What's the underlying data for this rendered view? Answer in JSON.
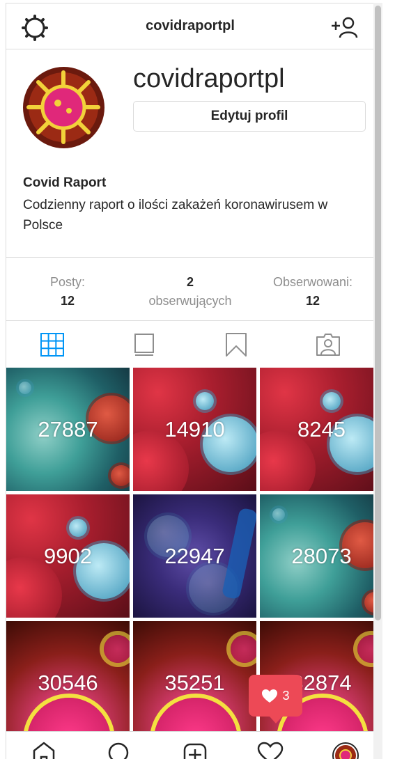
{
  "header": {
    "title": "covidraportpl",
    "settings_icon": "settings-gear-icon",
    "add_user_icon": "add-user-icon"
  },
  "profile": {
    "username": "covidraportpl",
    "edit_button": "Edytuj profil",
    "full_name": "Covid Raport",
    "bio": "Codzienny raport o ilości zakażeń koronawirusem w Polsce"
  },
  "stats": {
    "posts_label": "Posty:",
    "posts_value": "12",
    "followers_value": "2",
    "followers_label": "obserwujących",
    "following_label": "Obserwowani:",
    "following_value": "12"
  },
  "tabs": [
    {
      "name": "grid",
      "icon": "grid-icon",
      "active": true
    },
    {
      "name": "feed",
      "icon": "feed-icon",
      "active": false
    },
    {
      "name": "saved",
      "icon": "bookmark-icon",
      "active": false
    },
    {
      "name": "tagged",
      "icon": "tagged-person-icon",
      "active": false
    }
  ],
  "posts": [
    {
      "count": "27887",
      "theme": "teal"
    },
    {
      "count": "14910",
      "theme": "red-blue"
    },
    {
      "count": "8245",
      "theme": "red-blue"
    },
    {
      "count": "9902",
      "theme": "red-blue"
    },
    {
      "count": "22947",
      "theme": "purple"
    },
    {
      "count": "28073",
      "theme": "teal"
    },
    {
      "count": "30546",
      "theme": "yellow"
    },
    {
      "count": "35251",
      "theme": "yellow"
    },
    {
      "count": "32874",
      "theme": "yellow"
    }
  ],
  "notification": {
    "icon": "heart-icon",
    "count": "3"
  },
  "bottom_nav": [
    {
      "name": "home",
      "icon": "home-icon"
    },
    {
      "name": "search",
      "icon": "search-icon"
    },
    {
      "name": "new-post",
      "icon": "plus-square-icon"
    },
    {
      "name": "activity",
      "icon": "heart-icon"
    },
    {
      "name": "profile",
      "icon": "avatar"
    }
  ],
  "colors": {
    "accent": "#0095f6",
    "border": "#dbdbdb",
    "muted": "#8e8e8e",
    "notification": "#ed4956"
  }
}
